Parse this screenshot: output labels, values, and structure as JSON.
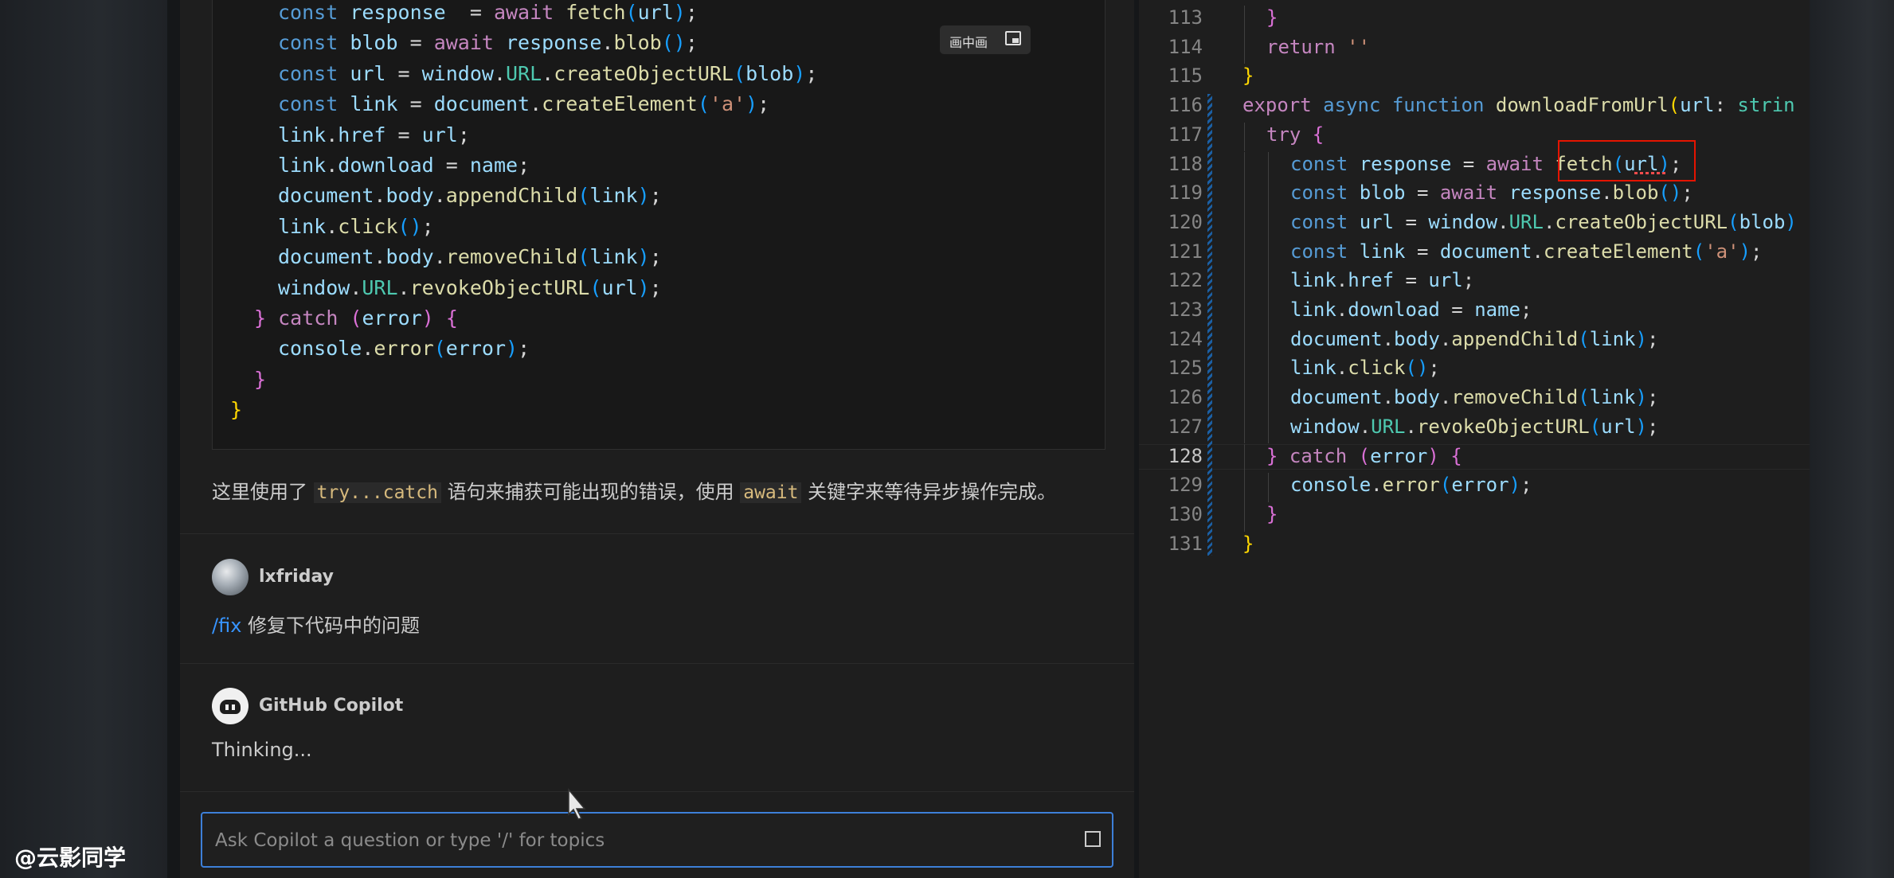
{
  "chat": {
    "code_lines": [
      {
        "indent": 4,
        "parts": [
          [
            "k",
            "const "
          ],
          [
            "v",
            "response"
          ],
          [
            "",
            "  = "
          ],
          [
            "kc",
            "await "
          ],
          [
            "fn",
            "fetch"
          ],
          [
            "pb",
            "("
          ],
          [
            "v",
            "url"
          ],
          [
            "pb",
            ")"
          ],
          [
            "",
            ";"
          ]
        ]
      },
      {
        "indent": 4,
        "parts": [
          [
            "k",
            "const "
          ],
          [
            "v",
            "blob"
          ],
          [
            "",
            " = "
          ],
          [
            "kc",
            "await "
          ],
          [
            "v",
            "response"
          ],
          [
            "",
            "."
          ],
          [
            "fn",
            "blob"
          ],
          [
            "pb",
            "()"
          ],
          [
            "",
            ";"
          ]
        ]
      },
      {
        "indent": 4,
        "parts": [
          [
            "k",
            "const "
          ],
          [
            "v",
            "url"
          ],
          [
            "",
            " = "
          ],
          [
            "v",
            "window"
          ],
          [
            "",
            "."
          ],
          [
            "cls",
            "URL"
          ],
          [
            "",
            "."
          ],
          [
            "fn",
            "createObjectURL"
          ],
          [
            "pb",
            "("
          ],
          [
            "v",
            "blob"
          ],
          [
            "pb",
            ")"
          ],
          [
            "",
            ";"
          ]
        ]
      },
      {
        "indent": 4,
        "parts": [
          [
            "k",
            "const "
          ],
          [
            "v",
            "link"
          ],
          [
            "",
            " = "
          ],
          [
            "v",
            "document"
          ],
          [
            "",
            "."
          ],
          [
            "fn",
            "createElement"
          ],
          [
            "pb",
            "("
          ],
          [
            "str",
            "'a'"
          ],
          [
            "pb",
            ")"
          ],
          [
            "",
            ";"
          ]
        ]
      },
      {
        "indent": 4,
        "parts": [
          [
            "v",
            "link"
          ],
          [
            "",
            "."
          ],
          [
            "v",
            "href"
          ],
          [
            "",
            " = "
          ],
          [
            "v",
            "url"
          ],
          [
            "",
            ";"
          ]
        ]
      },
      {
        "indent": 4,
        "parts": [
          [
            "v",
            "link"
          ],
          [
            "",
            "."
          ],
          [
            "v",
            "download"
          ],
          [
            "",
            " = "
          ],
          [
            "v",
            "name"
          ],
          [
            "",
            ";"
          ]
        ]
      },
      {
        "indent": 4,
        "parts": [
          [
            "v",
            "document"
          ],
          [
            "",
            "."
          ],
          [
            "v",
            "body"
          ],
          [
            "",
            "."
          ],
          [
            "fn",
            "appendChild"
          ],
          [
            "pb",
            "("
          ],
          [
            "v",
            "link"
          ],
          [
            "pb",
            ")"
          ],
          [
            "",
            ";"
          ]
        ]
      },
      {
        "indent": 4,
        "parts": [
          [
            "v",
            "link"
          ],
          [
            "",
            "."
          ],
          [
            "fn",
            "click"
          ],
          [
            "pb",
            "()"
          ],
          [
            "",
            ";"
          ]
        ]
      },
      {
        "indent": 4,
        "parts": [
          [
            "v",
            "document"
          ],
          [
            "",
            "."
          ],
          [
            "v",
            "body"
          ],
          [
            "",
            "."
          ],
          [
            "fn",
            "removeChild"
          ],
          [
            "pb",
            "("
          ],
          [
            "v",
            "link"
          ],
          [
            "pb",
            ")"
          ],
          [
            "",
            ";"
          ]
        ]
      },
      {
        "indent": 4,
        "parts": [
          [
            "v",
            "window"
          ],
          [
            "",
            "."
          ],
          [
            "cls",
            "URL"
          ],
          [
            "",
            "."
          ],
          [
            "fn",
            "revokeObjectURL"
          ],
          [
            "pb",
            "("
          ],
          [
            "v",
            "url"
          ],
          [
            "pb",
            ")"
          ],
          [
            "",
            ";"
          ]
        ]
      },
      {
        "indent": 2,
        "parts": [
          [
            "pa",
            "} "
          ],
          [
            "kc",
            "catch "
          ],
          [
            "pa",
            "("
          ],
          [
            "v",
            "error"
          ],
          [
            "pa",
            ") {"
          ]
        ]
      },
      {
        "indent": 4,
        "parts": [
          [
            "v",
            "console"
          ],
          [
            "",
            "."
          ],
          [
            "fn",
            "error"
          ],
          [
            "pb",
            "("
          ],
          [
            "v",
            "error"
          ],
          [
            "pb",
            ")"
          ],
          [
            "",
            ";"
          ]
        ]
      },
      {
        "indent": 2,
        "parts": [
          [
            "pa",
            "}"
          ]
        ]
      },
      {
        "indent": 0,
        "parts": [
          [
            "py",
            "}"
          ]
        ]
      }
    ],
    "explanation": {
      "pre": "这里使用了 ",
      "code1": "try...catch",
      "mid": " 语句来捕获可能出现的错误，使用 ",
      "code2": "await",
      "post": " 关键字来等待异步操作完成。"
    },
    "user": {
      "name": "lxfriday",
      "command": "/fix",
      "text": " 修复下代码中的问题"
    },
    "copilot": {
      "name": "GitHub Copilot",
      "status": "Thinking..."
    },
    "input_placeholder": "Ask Copilot a question or type '/' for topics",
    "pip_label": "画中画"
  },
  "editor": {
    "active_line": 128,
    "lines": [
      {
        "num": 113,
        "indent": 1,
        "parts": [
          [
            "pa",
            "}"
          ]
        ]
      },
      {
        "num": 114,
        "indent": 1,
        "parts": [
          [
            "kc",
            "return "
          ],
          [
            "str",
            "''"
          ]
        ]
      },
      {
        "num": 115,
        "indent": 0,
        "parts": [
          [
            "py",
            "}"
          ]
        ]
      },
      {
        "num": 116,
        "indent": 0,
        "parts": [
          [
            "kc",
            "export "
          ],
          [
            "k",
            "async function "
          ],
          [
            "fn",
            "downloadFromUrl"
          ],
          [
            "py",
            "("
          ],
          [
            "v",
            "url"
          ],
          [
            "",
            ": "
          ],
          [
            "cls",
            "strin"
          ]
        ]
      },
      {
        "num": 117,
        "indent": 1,
        "parts": [
          [
            "kc",
            "try "
          ],
          [
            "pa",
            "{"
          ]
        ]
      },
      {
        "num": 118,
        "indent": 2,
        "parts": [
          [
            "k",
            "const "
          ],
          [
            "v",
            "response"
          ],
          [
            "",
            " = "
          ],
          [
            "kc",
            "await "
          ],
          [
            "fn",
            "fetch"
          ],
          [
            "pb",
            "("
          ],
          [
            "v",
            "url"
          ],
          [
            "pb",
            ")"
          ],
          [
            "",
            ";"
          ]
        ]
      },
      {
        "num": 119,
        "indent": 2,
        "parts": [
          [
            "k",
            "const "
          ],
          [
            "v",
            "blob"
          ],
          [
            "",
            " = "
          ],
          [
            "kc",
            "await "
          ],
          [
            "v",
            "response"
          ],
          [
            "",
            "."
          ],
          [
            "fn",
            "blob"
          ],
          [
            "pb",
            "()"
          ],
          [
            "",
            ";"
          ]
        ]
      },
      {
        "num": 120,
        "indent": 2,
        "parts": [
          [
            "k",
            "const "
          ],
          [
            "v",
            "url"
          ],
          [
            "",
            " = "
          ],
          [
            "v",
            "window"
          ],
          [
            "",
            "."
          ],
          [
            "cls",
            "URL"
          ],
          [
            "",
            "."
          ],
          [
            "fn",
            "createObjectURL"
          ],
          [
            "pb",
            "("
          ],
          [
            "v",
            "blob"
          ],
          [
            "pb",
            ")"
          ]
        ]
      },
      {
        "num": 121,
        "indent": 2,
        "parts": [
          [
            "k",
            "const "
          ],
          [
            "v",
            "link"
          ],
          [
            "",
            " = "
          ],
          [
            "v",
            "document"
          ],
          [
            "",
            "."
          ],
          [
            "fn",
            "createElement"
          ],
          [
            "pb",
            "("
          ],
          [
            "str",
            "'a'"
          ],
          [
            "pb",
            ")"
          ],
          [
            "",
            ";"
          ]
        ]
      },
      {
        "num": 122,
        "indent": 2,
        "parts": [
          [
            "v",
            "link"
          ],
          [
            "",
            "."
          ],
          [
            "v",
            "href"
          ],
          [
            "",
            " = "
          ],
          [
            "v",
            "url"
          ],
          [
            "",
            ";"
          ]
        ]
      },
      {
        "num": 123,
        "indent": 2,
        "parts": [
          [
            "v",
            "link"
          ],
          [
            "",
            "."
          ],
          [
            "v",
            "download"
          ],
          [
            "",
            " = "
          ],
          [
            "v",
            "name"
          ],
          [
            "",
            ";"
          ]
        ]
      },
      {
        "num": 124,
        "indent": 2,
        "parts": [
          [
            "v",
            "document"
          ],
          [
            "",
            "."
          ],
          [
            "v",
            "body"
          ],
          [
            "",
            "."
          ],
          [
            "fn",
            "appendChild"
          ],
          [
            "pb",
            "("
          ],
          [
            "v",
            "link"
          ],
          [
            "pb",
            ")"
          ],
          [
            "",
            ";"
          ]
        ]
      },
      {
        "num": 125,
        "indent": 2,
        "parts": [
          [
            "v",
            "link"
          ],
          [
            "",
            "."
          ],
          [
            "fn",
            "click"
          ],
          [
            "pb",
            "()"
          ],
          [
            "",
            ";"
          ]
        ]
      },
      {
        "num": 126,
        "indent": 2,
        "parts": [
          [
            "v",
            "document"
          ],
          [
            "",
            "."
          ],
          [
            "v",
            "body"
          ],
          [
            "",
            "."
          ],
          [
            "fn",
            "removeChild"
          ],
          [
            "pb",
            "("
          ],
          [
            "v",
            "link"
          ],
          [
            "pb",
            ")"
          ],
          [
            "",
            ";"
          ]
        ]
      },
      {
        "num": 127,
        "indent": 2,
        "parts": [
          [
            "v",
            "window"
          ],
          [
            "",
            "."
          ],
          [
            "cls",
            "URL"
          ],
          [
            "",
            "."
          ],
          [
            "fn",
            "revokeObjectURL"
          ],
          [
            "pb",
            "("
          ],
          [
            "v",
            "url"
          ],
          [
            "pb",
            ")"
          ],
          [
            "",
            ";"
          ]
        ]
      },
      {
        "num": 128,
        "indent": 1,
        "parts": [
          [
            "pa",
            "} "
          ],
          [
            "kc",
            "catch "
          ],
          [
            "pa",
            "("
          ],
          [
            "v",
            "error"
          ],
          [
            "pa",
            ") {"
          ]
        ]
      },
      {
        "num": 129,
        "indent": 2,
        "parts": [
          [
            "v",
            "console"
          ],
          [
            "",
            "."
          ],
          [
            "fn",
            "error"
          ],
          [
            "pb",
            "("
          ],
          [
            "v",
            "error"
          ],
          [
            "pb",
            ")"
          ],
          [
            "",
            ";"
          ]
        ]
      },
      {
        "num": 130,
        "indent": 1,
        "parts": [
          [
            "pa",
            "}"
          ]
        ]
      },
      {
        "num": 131,
        "indent": 0,
        "parts": [
          [
            "py",
            "}"
          ]
        ]
      }
    ]
  },
  "watermark": "@云影同学",
  "colors": {
    "keyword": "#569cd6",
    "control": "#c586c0",
    "function": "#dcdcaa",
    "variable": "#9cdcfe",
    "highlight_box": "#e51400",
    "input_focus": "#3d7fd8"
  },
  "icons": [
    "pip-icon",
    "stop-square-icon",
    "copilot-avatar-icon",
    "cursor-icon"
  ]
}
